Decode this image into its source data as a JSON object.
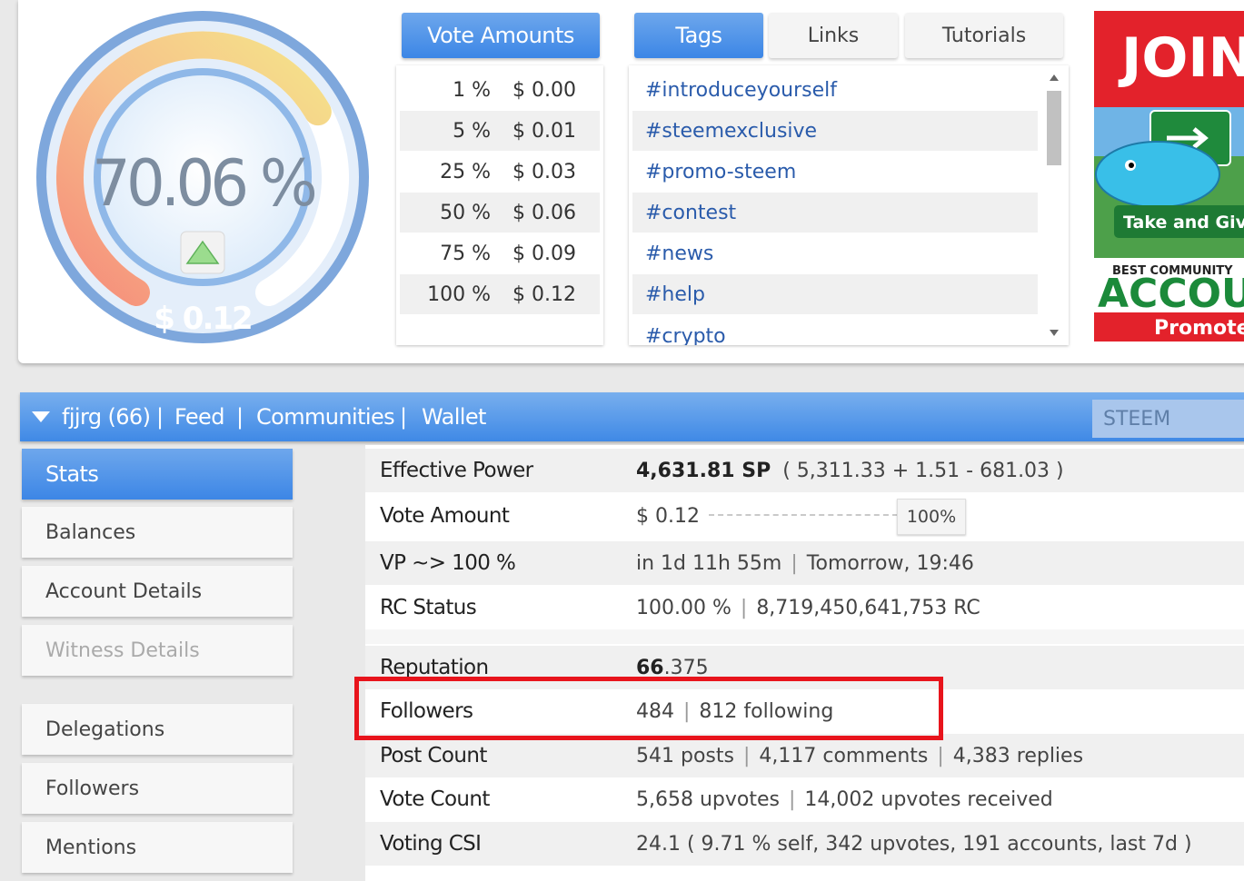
{
  "gauge": {
    "percent_text": "70.06 %",
    "value_text": "$ 0.12",
    "percent": 70.06
  },
  "vote_amounts": {
    "title": "Vote Amounts",
    "rows": [
      {
        "pct": "1 %",
        "val": "$ 0.00"
      },
      {
        "pct": "5 %",
        "val": "$ 0.01"
      },
      {
        "pct": "25 %",
        "val": "$ 0.03"
      },
      {
        "pct": "50 %",
        "val": "$ 0.06"
      },
      {
        "pct": "75 %",
        "val": "$ 0.09"
      },
      {
        "pct": "100 %",
        "val": "$ 0.12"
      }
    ]
  },
  "tabs": {
    "tags": "Tags",
    "links": "Links",
    "tutorials": "Tutorials"
  },
  "tags": [
    "#introduceyourself",
    "#steemexclusive",
    "#promo-steem",
    "#contest",
    "#news",
    "#help",
    "#crypto"
  ],
  "ad": {
    "top": "JOIN",
    "middle": "Take and Give",
    "small": "BEST COMMUNITY",
    "big": "ACCOU",
    "bottom": "Promote"
  },
  "nav": {
    "user": "fjjrg (66)",
    "feed": "Feed",
    "communities": "Communities",
    "wallet": "Wallet",
    "sep": "|",
    "currency": "STEEM"
  },
  "sidebar": [
    "Stats",
    "Balances",
    "Account Details",
    "Witness Details",
    "Delegations",
    "Followers",
    "Mentions"
  ],
  "stats": {
    "effective_power": {
      "label": "Effective Power",
      "main": "4,631.81 SP",
      "detail": "( 5,311.33 + 1.51 - 681.03 )"
    },
    "vote_amount": {
      "label": "Vote Amount",
      "value": "$ 0.12",
      "slider": "100%",
      "slider_level": 100
    },
    "vp": {
      "label": "VP ~> 100 %",
      "a": "in 1d 11h 55m",
      "b": "Tomorrow, 19:46"
    },
    "rc": {
      "label": "RC Status",
      "a": "100.00 %",
      "b": "8,719,450,641,753 RC"
    },
    "reputation": {
      "label": "Reputation",
      "main": "66",
      "rest": ".375"
    },
    "followers": {
      "label": "Followers",
      "a": "484",
      "b": "812 following"
    },
    "post_count": {
      "label": "Post Count",
      "a": "541 posts",
      "b": "4,117 comments",
      "c": "4,383 replies"
    },
    "vote_count": {
      "label": "Vote Count",
      "a": "5,658 upvotes",
      "b": "14,002 upvotes received"
    },
    "csi": {
      "label": "Voting CSI",
      "value": "24.1 ( 9.71 % self, 342 upvotes, 191 accounts, last 7d )"
    }
  },
  "colors": {
    "accent": "#3c86e6",
    "highlight": "#e8141c",
    "link": "#2a5bab"
  }
}
